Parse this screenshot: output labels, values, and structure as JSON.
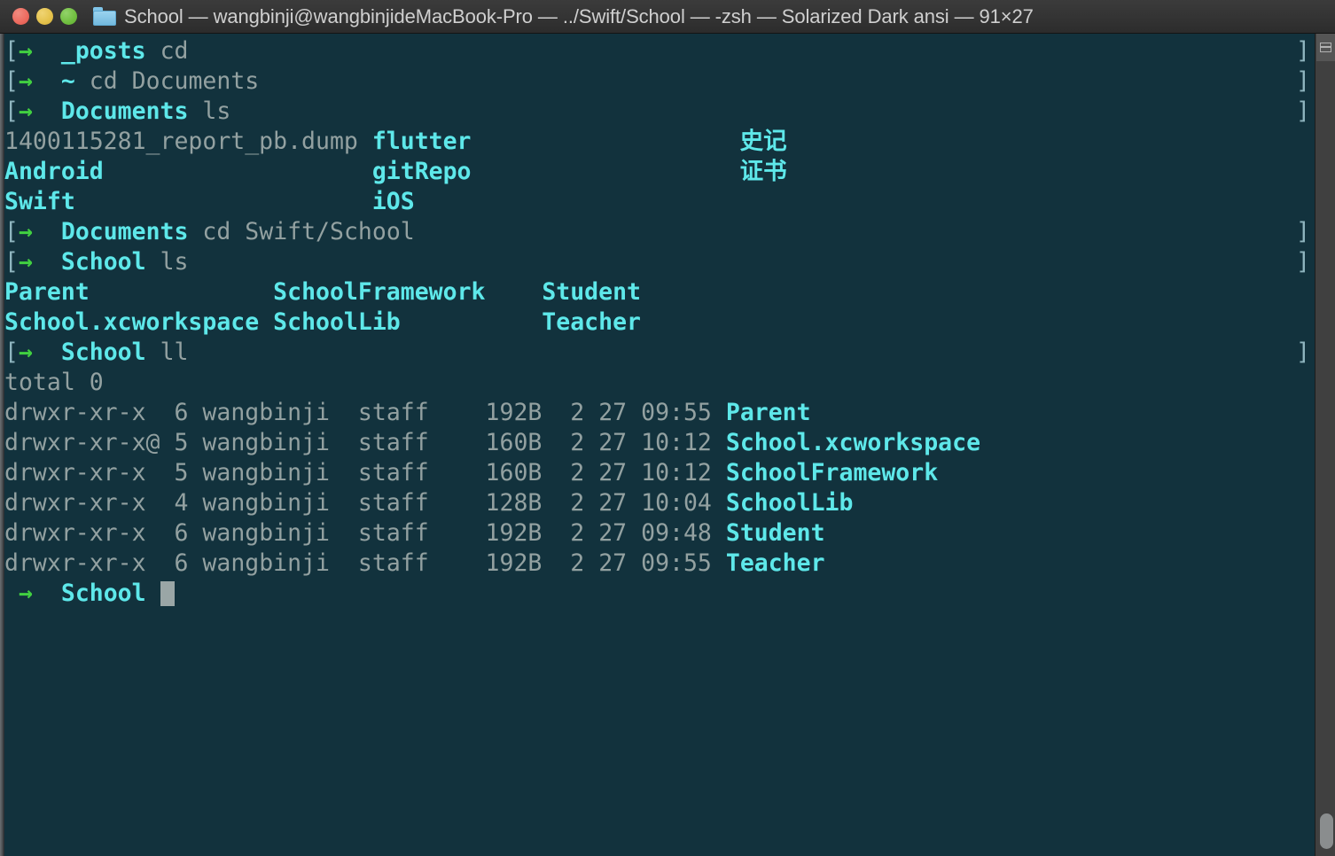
{
  "window": {
    "title": "School — wangbinji@wangbinjideMacBook-Pro — ../Swift/School — -zsh — Solarized Dark ansi — 91×27",
    "traffic_lights": [
      {
        "name": "close",
        "color": "#ed6a5e"
      },
      {
        "name": "minimize",
        "color": "#e4c14a"
      },
      {
        "name": "zoom",
        "color": "#70bf3f"
      }
    ],
    "proxy_icon": "folder-icon"
  },
  "theme": {
    "background": "#12323d",
    "foreground": "#93a1a1",
    "cyan": "#5ee8ea",
    "green": "#41d041",
    "bracket": "#8fb5bf",
    "cursor": "#9aa6a6",
    "titlebar": "#343434",
    "title_text": "#cfcfcf",
    "scrollbar": "#404040"
  },
  "terminal": {
    "columns": 91,
    "rows": 27,
    "prompt_open_bracket": "[",
    "prompt_arrow": "→",
    "prompt_close_bracket": "]",
    "cursor_visible": true,
    "lines": [
      {
        "type": "prompt",
        "bracketed": true,
        "dir": "_posts",
        "command": "cd"
      },
      {
        "type": "prompt",
        "bracketed": true,
        "dir": "~",
        "command": "cd Documents"
      },
      {
        "type": "prompt",
        "bracketed": true,
        "dir": "Documents",
        "command": "ls"
      },
      {
        "type": "ls",
        "cells": [
          {
            "text": "1400115281_report_pb.dump",
            "col": 1,
            "style": "grey"
          },
          {
            "text": "flutter",
            "col": 27,
            "style": "cyan"
          },
          {
            "text": "史记",
            "col": 53,
            "style": "cyan"
          }
        ]
      },
      {
        "type": "ls",
        "cells": [
          {
            "text": "Android",
            "col": 1,
            "style": "cyan"
          },
          {
            "text": "gitRepo",
            "col": 27,
            "style": "cyan"
          },
          {
            "text": "证书",
            "col": 53,
            "style": "cyan"
          }
        ]
      },
      {
        "type": "ls",
        "cells": [
          {
            "text": "Swift",
            "col": 1,
            "style": "cyan"
          },
          {
            "text": "iOS",
            "col": 27,
            "style": "cyan"
          }
        ]
      },
      {
        "type": "prompt",
        "bracketed": true,
        "dir": "Documents",
        "command": "cd Swift/School"
      },
      {
        "type": "prompt",
        "bracketed": true,
        "dir": "School",
        "command": "ls"
      },
      {
        "type": "ls",
        "cells": [
          {
            "text": "Parent",
            "col": 1,
            "style": "cyan"
          },
          {
            "text": "SchoolFramework",
            "col": 20,
            "style": "cyan"
          },
          {
            "text": "Student",
            "col": 39,
            "style": "cyan"
          }
        ]
      },
      {
        "type": "ls",
        "cells": [
          {
            "text": "School.xcworkspace",
            "col": 1,
            "style": "cyan"
          },
          {
            "text": "SchoolLib",
            "col": 20,
            "style": "cyan"
          },
          {
            "text": "Teacher",
            "col": 39,
            "style": "cyan"
          }
        ]
      },
      {
        "type": "prompt",
        "bracketed": true,
        "dir": "School",
        "command": "ll"
      },
      {
        "type": "plain",
        "text": "total 0"
      },
      {
        "type": "ll",
        "perms": "drwxr-xr-x",
        "links": "6",
        "owner": "wangbinji",
        "group": "staff",
        "size": "192B",
        "month": "2",
        "day": "27",
        "time": "09:55",
        "name": "Parent"
      },
      {
        "type": "ll",
        "perms": "drwxr-xr-x@",
        "links": "5",
        "owner": "wangbinji",
        "group": "staff",
        "size": "160B",
        "month": "2",
        "day": "27",
        "time": "10:12",
        "name": "School.xcworkspace"
      },
      {
        "type": "ll",
        "perms": "drwxr-xr-x",
        "links": "5",
        "owner": "wangbinji",
        "group": "staff",
        "size": "160B",
        "month": "2",
        "day": "27",
        "time": "10:12",
        "name": "SchoolFramework"
      },
      {
        "type": "ll",
        "perms": "drwxr-xr-x",
        "links": "4",
        "owner": "wangbinji",
        "group": "staff",
        "size": "128B",
        "month": "2",
        "day": "27",
        "time": "10:04",
        "name": "SchoolLib"
      },
      {
        "type": "ll",
        "perms": "drwxr-xr-x",
        "links": "6",
        "owner": "wangbinji",
        "group": "staff",
        "size": "192B",
        "month": "2",
        "day": "27",
        "time": "09:48",
        "name": "Student"
      },
      {
        "type": "ll",
        "perms": "drwxr-xr-x",
        "links": "6",
        "owner": "wangbinji",
        "group": "staff",
        "size": "192B",
        "month": "2",
        "day": "27",
        "time": "09:55",
        "name": "Teacher"
      },
      {
        "type": "prompt",
        "bracketed": false,
        "dir": "School",
        "command": "",
        "cursor": true
      }
    ]
  },
  "scrollbar": {
    "marker_icon": "list-lines-icon",
    "thumb_position": "bottom"
  }
}
